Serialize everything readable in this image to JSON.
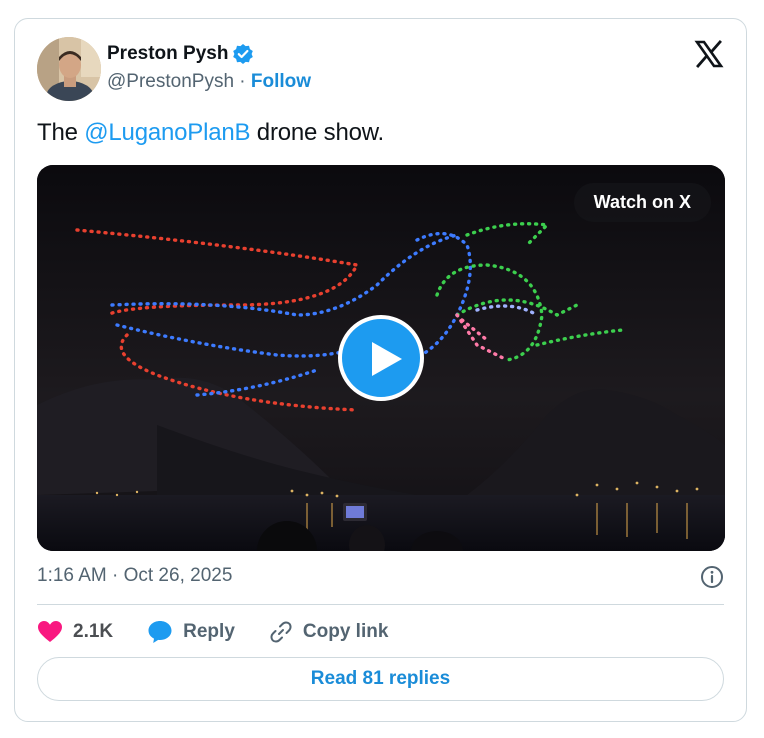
{
  "author": {
    "name": "Preston Pysh",
    "handle": "@PrestonPysh",
    "separator": "·",
    "follow_label": "Follow"
  },
  "tweet": {
    "text_before": "The ",
    "mention": "@LuganoPlanB",
    "text_after": " drone show."
  },
  "media": {
    "watch_label": "Watch on X"
  },
  "meta": {
    "timestamp": "1:16 AM · Oct 26, 2025"
  },
  "actions": {
    "like_count": "2.1K",
    "reply_label": "Reply",
    "copy_link_label": "Copy link"
  },
  "footer": {
    "read_replies_label": "Read 81 replies"
  },
  "colors": {
    "accent": "#1d9bf0",
    "like": "#f91880",
    "muted": "#536471"
  }
}
